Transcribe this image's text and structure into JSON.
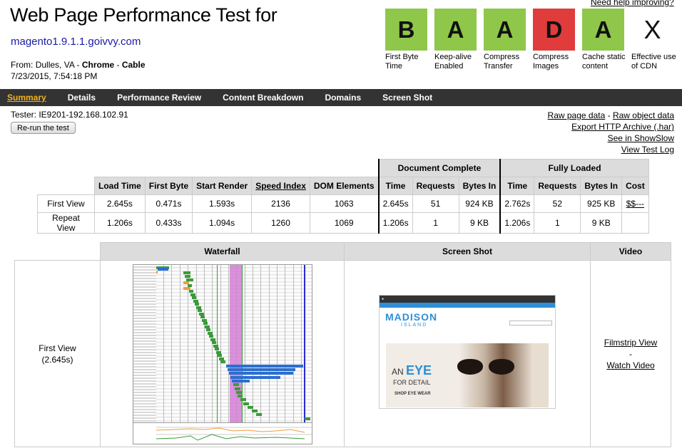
{
  "header": {
    "title": "Web Page Performance Test for",
    "site": "magento1.9.1.1.goivvy.com",
    "from_label": "From:",
    "location": "Dulles, VA",
    "browser": "Chrome",
    "connection": "Cable",
    "date": "7/23/2015, 7:54:18 PM",
    "help_link": "Need help improving?"
  },
  "grades": [
    {
      "letter": "B",
      "label": "First Byte Time",
      "color": "#8fc74a"
    },
    {
      "letter": "A",
      "label": "Keep-alive Enabled",
      "color": "#8fc74a"
    },
    {
      "letter": "A",
      "label": "Compress Transfer",
      "color": "#8fc74a"
    },
    {
      "letter": "D",
      "label": "Compress Images",
      "color": "#e03c3c"
    },
    {
      "letter": "A",
      "label": "Cache static content",
      "color": "#8fc74a"
    },
    {
      "letter": "X",
      "label": "Effective use of CDN",
      "color": "#ffffff"
    }
  ],
  "nav": [
    "Summary",
    "Details",
    "Performance Review",
    "Content Breakdown",
    "Domains",
    "Screen Shot"
  ],
  "tester": "Tester: IE9201-192.168.102.91",
  "rerun_label": "Re-run the test",
  "links": {
    "raw_page": "Raw page data",
    "raw_object": "Raw object data",
    "export_har": "Export HTTP Archive (.har)",
    "showslow": "See in ShowSlow",
    "test_log": "View Test Log"
  },
  "results": {
    "group_doc": "Document Complete",
    "group_full": "Fully Loaded",
    "columns": [
      "Load Time",
      "First Byte",
      "Start Render",
      "Speed Index",
      "DOM Elements",
      "Time",
      "Requests",
      "Bytes In",
      "Time",
      "Requests",
      "Bytes In",
      "Cost"
    ],
    "rows": [
      {
        "label": "First View",
        "cells": [
          "2.645s",
          "0.471s",
          "1.593s",
          "2136",
          "1063",
          "2.645s",
          "51",
          "924 KB",
          "2.762s",
          "52",
          "925 KB",
          "$$---"
        ]
      },
      {
        "label": "Repeat View",
        "cells": [
          "1.206s",
          "0.433s",
          "1.094s",
          "1260",
          "1069",
          "1.206s",
          "1",
          "9 KB",
          "1.206s",
          "1",
          "9 KB",
          ""
        ]
      }
    ]
  },
  "media": {
    "waterfall_header": "Waterfall",
    "screenshot_header": "Screen Shot",
    "video_header": "Video",
    "first_view": "First View",
    "first_view_time": "(2.645s)",
    "filmstrip": "Filmstrip View",
    "dash": "-",
    "watch_video": "Watch Video"
  },
  "screenshot_content": {
    "brand": "MADISON",
    "brand_sub": "ISLAND",
    "headline_an": "AN",
    "headline_eye": "EYE",
    "headline_detail": "FOR DETAIL",
    "headline_shop": "SHOP EYE WEAR"
  }
}
